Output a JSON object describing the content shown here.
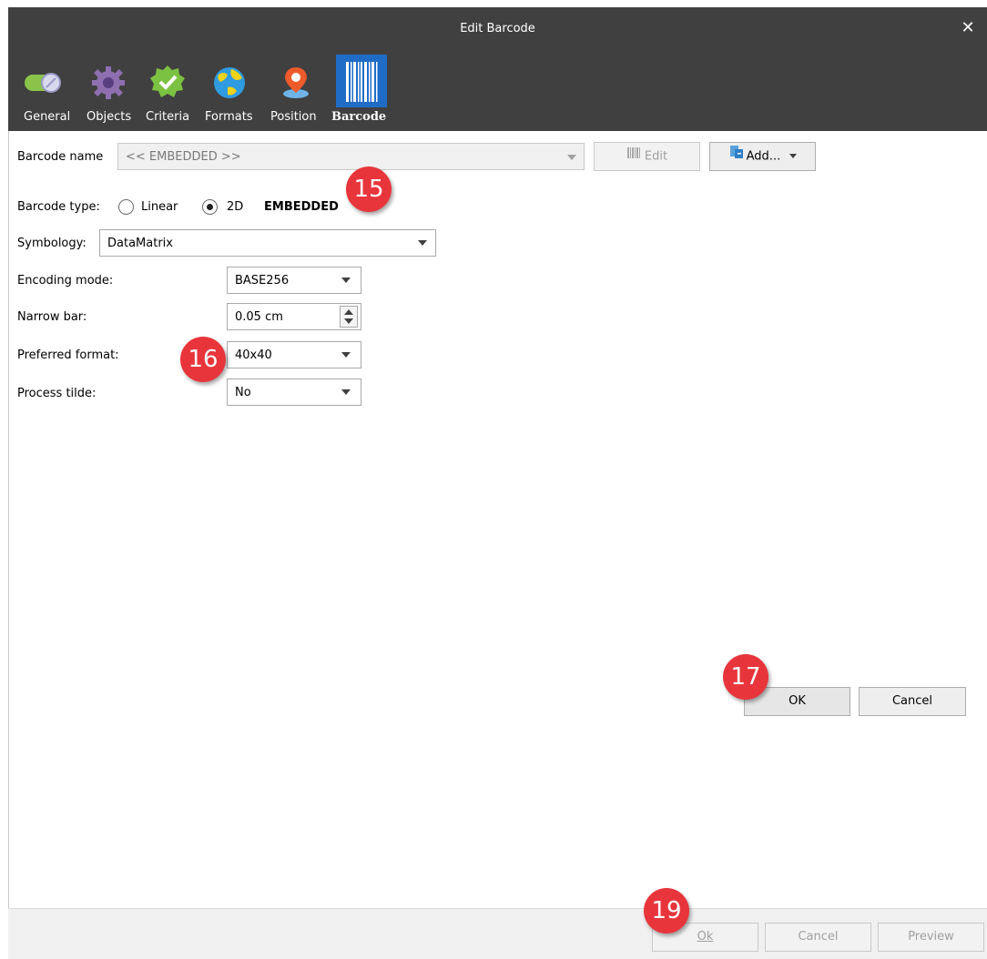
{
  "window": {
    "title": "Edit Barcode",
    "close_glyph": "✕"
  },
  "tabs": [
    {
      "label": "General",
      "icon": "toggle-icon"
    },
    {
      "label": "Objects",
      "icon": "gear-icon"
    },
    {
      "label": "Criteria",
      "icon": "checkmark-badge-icon"
    },
    {
      "label": "Formats",
      "icon": "globe-icon"
    },
    {
      "label": "Position",
      "icon": "map-pin-icon"
    },
    {
      "label": "Barcode",
      "icon": "barcode-icon",
      "active": true
    }
  ],
  "form": {
    "barcode_name_label": "Barcode name",
    "barcode_name_value": "<< EMBEDDED >>",
    "edit_button": "Edit",
    "add_button": "Add...",
    "barcode_type_label": "Barcode type:",
    "type_linear": "Linear",
    "type_2d": "2D",
    "type_selected": "2D",
    "embedded_tag": "EMBEDDED",
    "symbology_label": "Symbology:",
    "symbology_value": "DataMatrix",
    "encoding_label": "Encoding mode:",
    "encoding_value": "BASE256",
    "narrow_bar_label": "Narrow bar:",
    "narrow_bar_value": "0.05 cm",
    "preferred_format_label": "Preferred format:",
    "preferred_format_value": "40x40",
    "process_tilde_label": "Process tilde:",
    "process_tilde_value": "No",
    "ok_button": "OK",
    "cancel_button": "Cancel"
  },
  "footer": {
    "ok": "Ok",
    "cancel": "Cancel",
    "preview": "Preview"
  },
  "annotations": [
    "15",
    "16",
    "17",
    "19"
  ],
  "colors": {
    "titlebar": "#404040",
    "active_tab": "#1f6cc7",
    "badge": "#e8353c"
  }
}
